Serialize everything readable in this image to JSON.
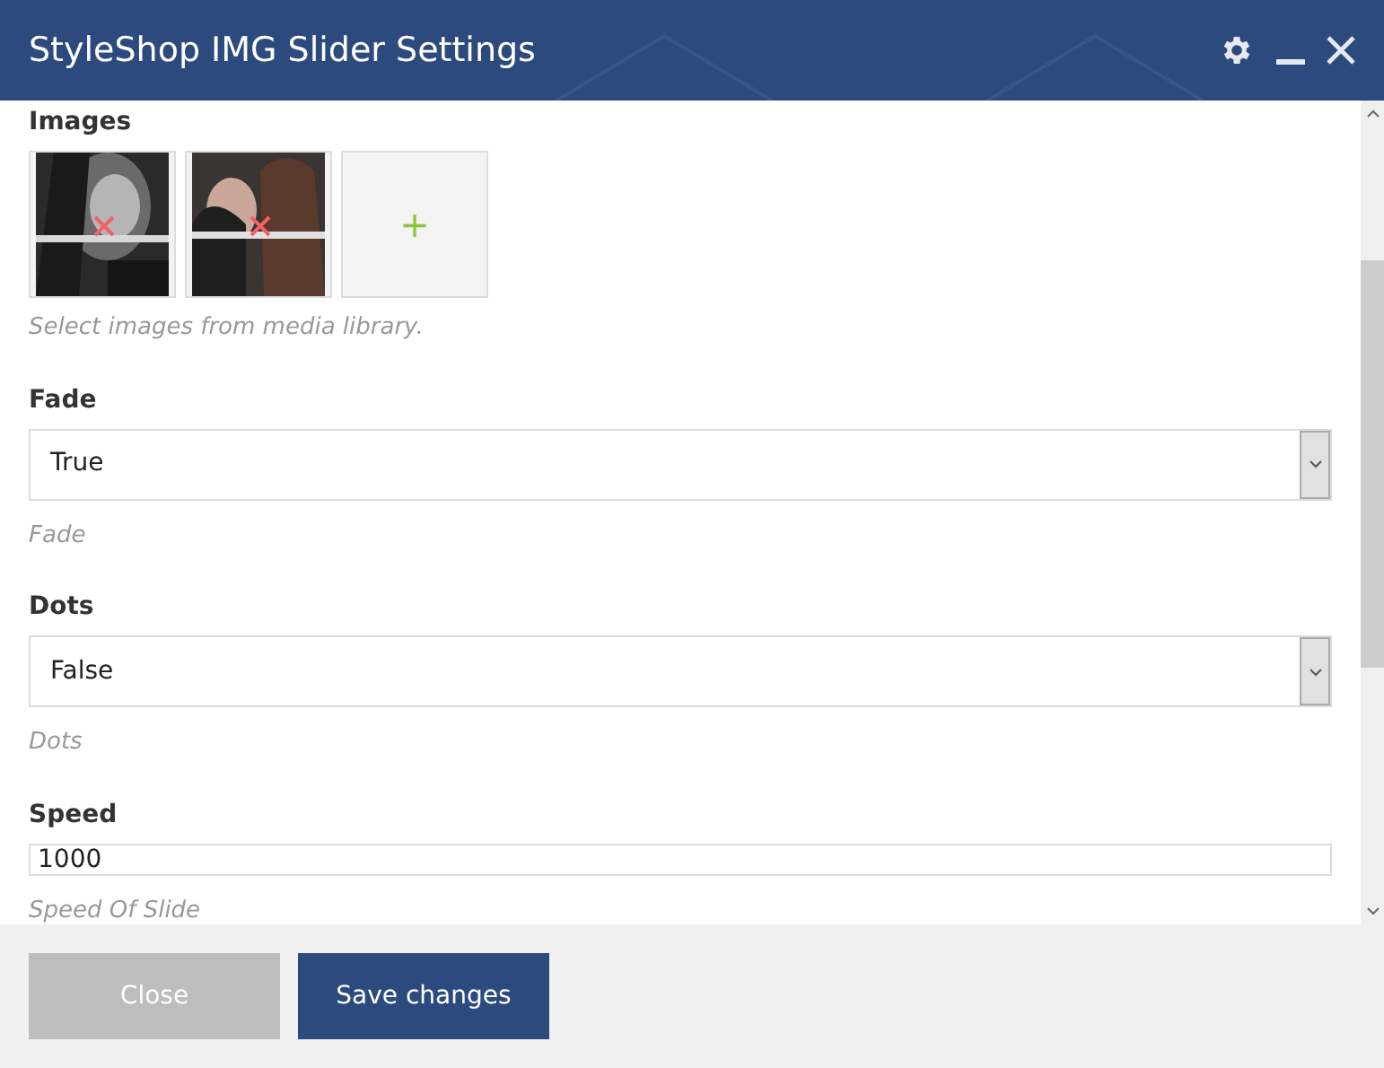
{
  "window": {
    "title": "StyleShop IMG Slider Settings"
  },
  "fields": [
    {
      "kind": "images",
      "label": "Images",
      "add_tile": "+",
      "hint": "Select images from media library."
    },
    {
      "kind": "select",
      "label": "Fade",
      "value": "True",
      "hint": "Fade"
    },
    {
      "kind": "select",
      "label": "Dots",
      "value": "False",
      "hint": "Dots"
    },
    {
      "kind": "input",
      "label": "Speed",
      "value": "1000",
      "hint": "Speed Of Slide"
    }
  ],
  "buttons": [
    {
      "label": "Close",
      "kind": "secondary"
    },
    {
      "label": "Save changes",
      "kind": "primary"
    }
  ]
}
